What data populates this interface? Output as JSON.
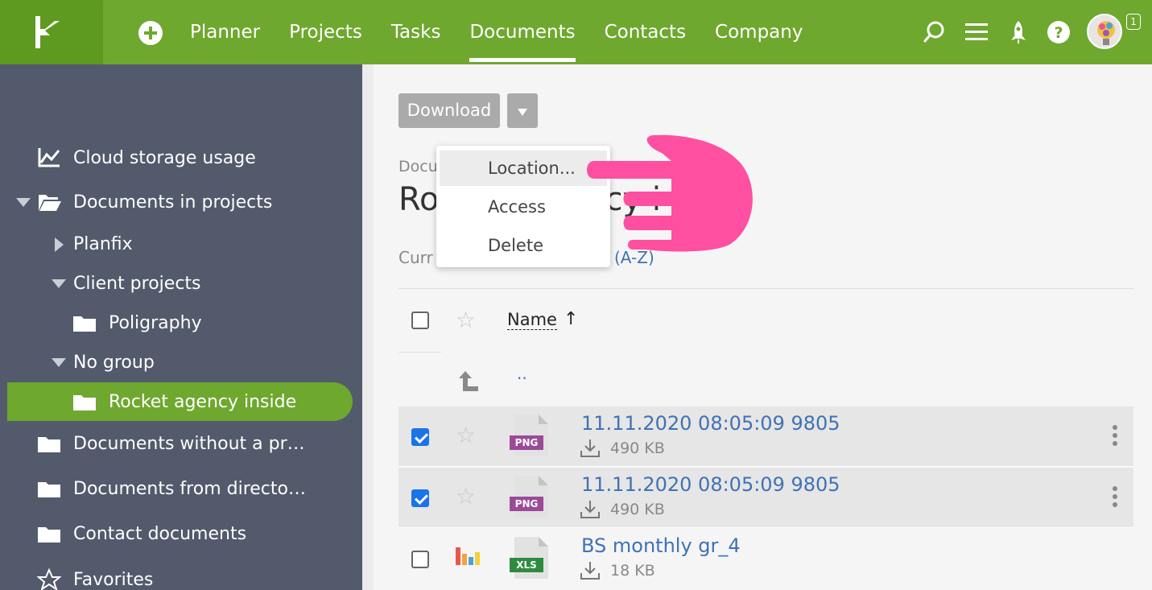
{
  "topbar": {
    "nav": [
      {
        "label": "Planner"
      },
      {
        "label": "Projects"
      },
      {
        "label": "Tasks"
      },
      {
        "label": "Documents"
      },
      {
        "label": "Contacts"
      },
      {
        "label": "Company"
      }
    ],
    "active_nav": "Documents",
    "notifications_count": "1",
    "icons": [
      "add-icon",
      "search-icon",
      "menu-icon",
      "rocket-icon",
      "help-icon"
    ]
  },
  "sidebar": {
    "items": [
      {
        "label": "Cloud storage usage",
        "icon": "chart-icon"
      },
      {
        "label": "Documents in projects",
        "icon": "folder-open-icon"
      },
      {
        "label": "Planfix",
        "icon": "triangle-right-icon"
      },
      {
        "label": "Client projects",
        "icon": "triangle-down-icon"
      },
      {
        "label": "Poligraphy",
        "icon": "folder-icon"
      },
      {
        "label": "No group",
        "icon": "triangle-down-icon"
      },
      {
        "label": "Rocket agency inside",
        "icon": "folder-icon"
      },
      {
        "label": "Documents without a pr…",
        "icon": "folder-icon"
      },
      {
        "label": "Documents from directo…",
        "icon": "folder-icon"
      },
      {
        "label": "Contact documents",
        "icon": "folder-icon"
      },
      {
        "label": "Favorites",
        "icon": "star-icon"
      }
    ]
  },
  "toolbar": {
    "download_label": "Download"
  },
  "dropdown": {
    "items": [
      {
        "label": "Location..."
      },
      {
        "label": "Access"
      },
      {
        "label": "Delete"
      }
    ]
  },
  "main": {
    "breadcrumb": "Docu",
    "title_start": "Ro",
    "title_end": "cy i",
    "sort_prefix": "Curr",
    "sort_value": "(A-Z)",
    "column_name": "Name",
    "sort_arrow": "↑",
    "up_link": "..",
    "files": [
      {
        "name": "11.11.2020 08:05:09 9805",
        "size": "490 KB",
        "type": "PNG",
        "checked": true
      },
      {
        "name": "11.11.2020 08:05:09 9805",
        "size": "490 KB",
        "type": "PNG",
        "checked": true
      },
      {
        "name": "BS monthly gr_4",
        "size": "18 KB",
        "type": "XLS",
        "checked": false
      }
    ]
  },
  "colors": {
    "brand_green": "#6ea82e",
    "sidebar_bg": "#525a6b",
    "link_blue": "#3f72b5",
    "hand_pink": "#ff4fa0"
  }
}
